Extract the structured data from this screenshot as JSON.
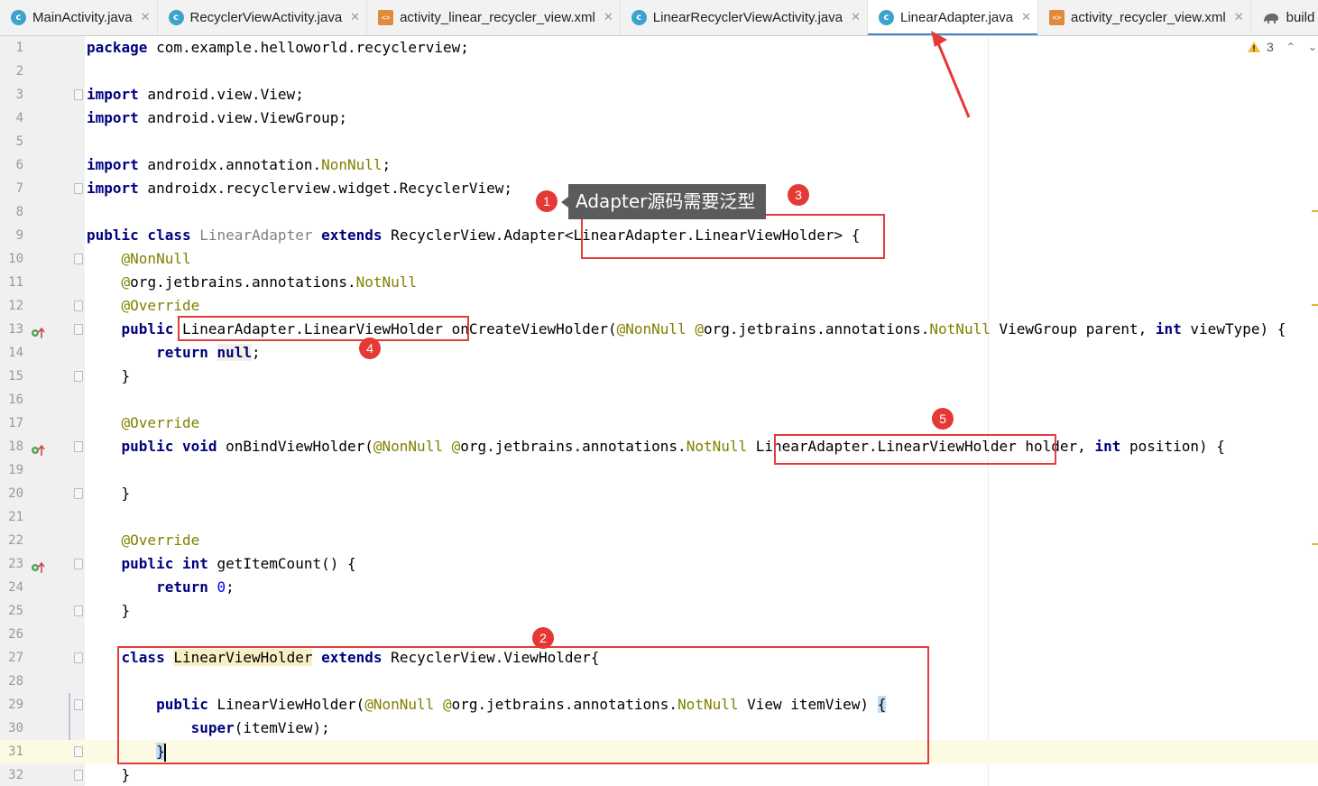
{
  "tabs": [
    {
      "label": "MainActivity.java",
      "type": "java",
      "active": false
    },
    {
      "label": "RecyclerViewActivity.java",
      "type": "java",
      "active": false
    },
    {
      "label": "activity_linear_recycler_view.xml",
      "type": "xml",
      "active": false
    },
    {
      "label": "LinearRecyclerViewActivity.java",
      "type": "java",
      "active": false
    },
    {
      "label": "LinearAdapter.java",
      "type": "java",
      "active": true
    },
    {
      "label": "activity_recycler_view.xml",
      "type": "xml",
      "active": false
    },
    {
      "label": "build",
      "type": "gradle",
      "active": false
    }
  ],
  "inspections": {
    "warning_count": "3"
  },
  "code_lines": [
    {
      "n": "1",
      "code": [
        [
          "kw",
          "package"
        ],
        [
          "p",
          " com.example.helloworld.recyclerview;"
        ]
      ]
    },
    {
      "n": "2",
      "code": []
    },
    {
      "n": "3",
      "fold": true,
      "code": [
        [
          "kw",
          "import"
        ],
        [
          "p",
          " android.view.View;"
        ]
      ]
    },
    {
      "n": "4",
      "code": [
        [
          "kw",
          "import"
        ],
        [
          "p",
          " android.view.ViewGroup;"
        ]
      ]
    },
    {
      "n": "5",
      "code": []
    },
    {
      "n": "6",
      "code": [
        [
          "kw",
          "import"
        ],
        [
          "p",
          " androidx.annotation."
        ],
        [
          "ann",
          "NonNull"
        ],
        [
          "p",
          ";"
        ]
      ]
    },
    {
      "n": "7",
      "fold": true,
      "code": [
        [
          "kw",
          "import"
        ],
        [
          "p",
          " androidx.recyclerview.widget.RecyclerView;"
        ]
      ]
    },
    {
      "n": "8",
      "code": []
    },
    {
      "n": "9",
      "code": [
        [
          "kw",
          "public class"
        ],
        [
          "p",
          " "
        ],
        [
          "cls",
          "LinearAdapter"
        ],
        [
          "p",
          " "
        ],
        [
          "kw",
          "extends"
        ],
        [
          "p",
          " RecyclerView.Adapter<LinearAdapter.LinearViewHolder> {"
        ]
      ]
    },
    {
      "n": "10",
      "fold": true,
      "code": [
        [
          "p",
          "    "
        ],
        [
          "ann",
          "@NonNull"
        ]
      ]
    },
    {
      "n": "11",
      "code": [
        [
          "p",
          "    "
        ],
        [
          "ann",
          "@"
        ],
        [
          "p",
          "org.jetbrains.annotations."
        ],
        [
          "ann",
          "NotNull"
        ]
      ]
    },
    {
      "n": "12",
      "fold": true,
      "code": [
        [
          "p",
          "    "
        ],
        [
          "ann",
          "@Override"
        ]
      ]
    },
    {
      "n": "13",
      "fold": true,
      "mark": true,
      "code": [
        [
          "p",
          "    "
        ],
        [
          "kw",
          "public"
        ],
        [
          "p",
          " LinearAdapter.LinearViewHolder onCreateViewHolder("
        ],
        [
          "ann",
          "@NonNull"
        ],
        [
          "p",
          " "
        ],
        [
          "ann",
          "@"
        ],
        [
          "p",
          "org.jetbrains.annotations."
        ],
        [
          "ann",
          "NotNull"
        ],
        [
          "p",
          " ViewGroup parent, "
        ],
        [
          "kw",
          "int"
        ],
        [
          "p",
          " viewType) {"
        ]
      ]
    },
    {
      "n": "14",
      "code": [
        [
          "p",
          "        "
        ],
        [
          "kw",
          "return"
        ],
        [
          "p",
          " "
        ],
        [
          "kwnull",
          "null"
        ],
        [
          "p",
          ";"
        ]
      ]
    },
    {
      "n": "15",
      "fold": true,
      "code": [
        [
          "p",
          "    }"
        ]
      ]
    },
    {
      "n": "16",
      "code": []
    },
    {
      "n": "17",
      "code": [
        [
          "p",
          "    "
        ],
        [
          "ann",
          "@Override"
        ]
      ]
    },
    {
      "n": "18",
      "fold": true,
      "mark": true,
      "code": [
        [
          "p",
          "    "
        ],
        [
          "kw",
          "public void"
        ],
        [
          "p",
          " onBindViewHolder("
        ],
        [
          "ann",
          "@NonNull"
        ],
        [
          "p",
          " "
        ],
        [
          "ann",
          "@"
        ],
        [
          "p",
          "org.jetbrains.annotations."
        ],
        [
          "ann",
          "NotNull"
        ],
        [
          "p",
          " LinearAdapter.LinearViewHolder holder, "
        ],
        [
          "kw",
          "int"
        ],
        [
          "p",
          " position) {"
        ]
      ]
    },
    {
      "n": "19",
      "code": []
    },
    {
      "n": "20",
      "fold": true,
      "code": [
        [
          "p",
          "    }"
        ]
      ]
    },
    {
      "n": "21",
      "code": []
    },
    {
      "n": "22",
      "code": [
        [
          "p",
          "    "
        ],
        [
          "ann",
          "@Override"
        ]
      ]
    },
    {
      "n": "23",
      "fold": true,
      "mark": true,
      "code": [
        [
          "p",
          "    "
        ],
        [
          "kw",
          "public int"
        ],
        [
          "p",
          " getItemCount() {"
        ]
      ]
    },
    {
      "n": "24",
      "code": [
        [
          "p",
          "        "
        ],
        [
          "kw",
          "return"
        ],
        [
          "p",
          " "
        ],
        [
          "numlit",
          "0"
        ],
        [
          "p",
          ";"
        ]
      ]
    },
    {
      "n": "25",
      "fold": true,
      "code": [
        [
          "p",
          "    }"
        ]
      ]
    },
    {
      "n": "26",
      "code": []
    },
    {
      "n": "27",
      "fold": true,
      "code": [
        [
          "p",
          "    "
        ],
        [
          "kw",
          "class"
        ],
        [
          "p",
          " "
        ],
        [
          "hlcls",
          "LinearViewHolder"
        ],
        [
          "p",
          " "
        ],
        [
          "kw",
          "extends"
        ],
        [
          "p",
          " RecyclerView.ViewHolder{"
        ]
      ]
    },
    {
      "n": "28",
      "code": []
    },
    {
      "n": "29",
      "fold": true,
      "code": [
        [
          "p",
          "        "
        ],
        [
          "kw",
          "public"
        ],
        [
          "p",
          " LinearViewHolder("
        ],
        [
          "ann",
          "@NonNull"
        ],
        [
          "p",
          " "
        ],
        [
          "ann",
          "@"
        ],
        [
          "p",
          "org.jetbrains.annotations."
        ],
        [
          "ann",
          "NotNull"
        ],
        [
          "p",
          " View itemView) "
        ],
        [
          "brace",
          "{"
        ]
      ]
    },
    {
      "n": "30",
      "code": [
        [
          "p",
          "            "
        ],
        [
          "kw",
          "super"
        ],
        [
          "p",
          "(itemView);"
        ]
      ]
    },
    {
      "n": "31",
      "fold": true,
      "current": true,
      "code": [
        [
          "p",
          "        "
        ],
        [
          "brace",
          "}"
        ],
        [
          "caret",
          ""
        ]
      ]
    },
    {
      "n": "32",
      "fold": true,
      "code": [
        [
          "p",
          "    }"
        ]
      ]
    }
  ],
  "annotations": {
    "badges": [
      "1",
      "2",
      "3",
      "4",
      "5"
    ],
    "callout_text": "Adapter源码需要泛型"
  },
  "colors": {
    "keyword": "#000080",
    "annotation": "#808000",
    "unused_class": "#808080",
    "number": "#0000ff",
    "annotation_red": "#e53c3c",
    "tab_active_underline": "#4a88c7"
  }
}
